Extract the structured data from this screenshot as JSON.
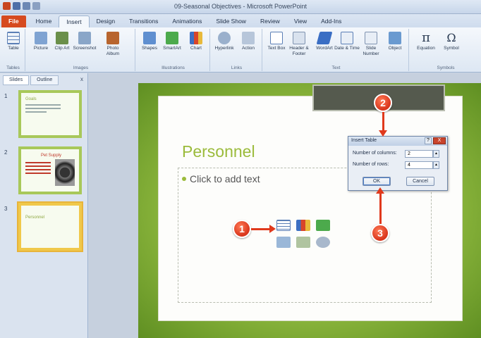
{
  "window": {
    "title": "09-Seasonal Objectives - Microsoft PowerPoint"
  },
  "ribbon_tabs": [
    "File",
    "Home",
    "Insert",
    "Design",
    "Transitions",
    "Animations",
    "Slide Show",
    "Review",
    "View",
    "Add-Ins"
  ],
  "ribbon_groups": [
    "Tables",
    "Images",
    "Illustrations",
    "Links",
    "Text",
    "Symbols"
  ],
  "ribbon_buttons": {
    "table": "Table",
    "picture": "Picture",
    "clip_art": "Clip Art",
    "screenshot": "Screenshot",
    "photo_album": "Photo Album",
    "shapes": "Shapes",
    "smartart": "SmartArt",
    "chart": "Chart",
    "hyperlink": "Hyperlink",
    "action": "Action",
    "text_box": "Text Box",
    "header_footer": "Header & Footer",
    "wordart": "WordArt",
    "date_time": "Date & Time",
    "slide_number": "Slide Number",
    "object": "Object",
    "equation": "Equation",
    "symbol": "Symbol"
  },
  "slides_pane": {
    "tabs": [
      "Slides",
      "Outline"
    ],
    "close_glyph": "x",
    "thumbnails": [
      {
        "number": "1",
        "title": "Goals"
      },
      {
        "number": "2",
        "title": "Pet Supply"
      },
      {
        "number": "3",
        "title": "Personnel"
      }
    ]
  },
  "slide": {
    "title": "Personnel",
    "placeholder_text": "Click to add text"
  },
  "dialog": {
    "title": "Insert Table",
    "help_glyph": "?",
    "close_glyph": "X",
    "columns_label": "Number of columns:",
    "columns_value": "2",
    "rows_label": "Number of rows:",
    "rows_value": "4",
    "ok_label": "OK",
    "cancel_label": "Cancel"
  },
  "callouts": {
    "step1": "1",
    "step2": "2",
    "step3": "3"
  },
  "colors": {
    "accent_red": "#e0391c",
    "slide_green": "#9bbb3b",
    "file_tab": "#d64a1f"
  }
}
